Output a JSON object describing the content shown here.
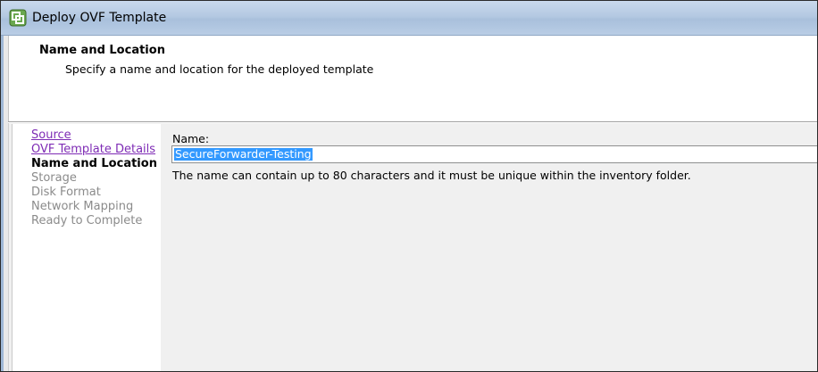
{
  "window": {
    "title": "Deploy OVF Template"
  },
  "header": {
    "title": "Name and Location",
    "subtitle": "Specify a name and location for the deployed template"
  },
  "nav": {
    "items": [
      {
        "label": "Source",
        "state": "link"
      },
      {
        "label": "OVF Template Details",
        "state": "link"
      },
      {
        "label": "Name and Location",
        "state": "current"
      },
      {
        "label": "Storage",
        "state": "disabled"
      },
      {
        "label": "Disk Format",
        "state": "disabled"
      },
      {
        "label": "Network Mapping",
        "state": "disabled"
      },
      {
        "label": "Ready to Complete",
        "state": "disabled"
      }
    ]
  },
  "form": {
    "name_label": "Name:",
    "name_value": "SecureForwarder-Testing",
    "hint": "The name can contain up to 80 characters and it must be unique within the inventory folder."
  },
  "icons": {
    "app": "vsphere-logo-icon"
  },
  "colors": {
    "link": "#7e2bb5",
    "selection": "#3399ff",
    "disabled": "#8b8b8b"
  }
}
